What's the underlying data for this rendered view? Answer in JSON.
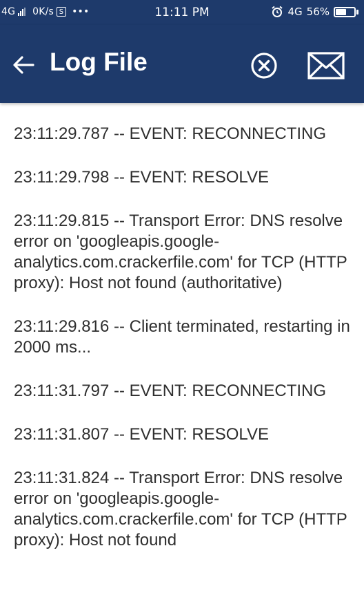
{
  "status_bar": {
    "network": "4G",
    "speed": "0K/s",
    "s_badge": "S",
    "more": "•••",
    "time": "11:11 PM",
    "net2": "4G",
    "battery": "56%",
    "battery_level": 0.56
  },
  "app_bar": {
    "title": "Log File",
    "background": "#1e3a6b"
  },
  "log": {
    "entries": [
      "23:11:29.787 -- EVENT: RECONNECTING",
      "23:11:29.798 -- EVENT: RESOLVE",
      "23:11:29.815 -- Transport Error: DNS resolve error on 'googleapis.google-analytics.com.crackerfile.com' for TCP (HTTP proxy): Host not found (authoritative)",
      "23:11:29.816 -- Client terminated, restarting in 2000 ms...",
      "23:11:31.797 -- EVENT: RECONNECTING",
      "23:11:31.807 -- EVENT: RESOLVE",
      "23:11:31.824 -- Transport Error: DNS resolve error on 'googleapis.google-analytics.com.crackerfile.com' for TCP (HTTP proxy): Host not found"
    ]
  }
}
